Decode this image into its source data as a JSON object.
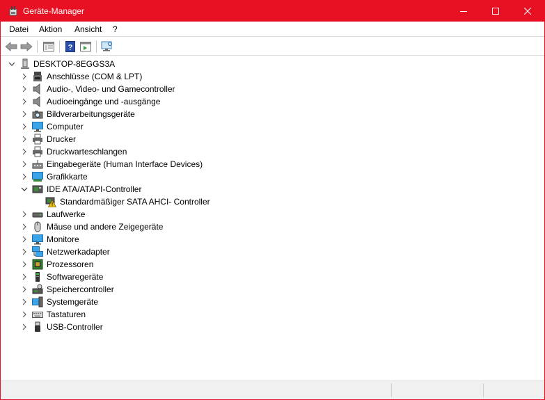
{
  "window": {
    "title": "Geräte-Manager",
    "accent": "#e81123"
  },
  "menu": {
    "items": [
      "Datei",
      "Aktion",
      "Ansicht",
      "?"
    ]
  },
  "toolbar": {
    "buttons": [
      "back-icon",
      "forward-icon",
      "properties-icon",
      "help-icon",
      "view-icon",
      "monitor-scan-icon"
    ]
  },
  "tree": {
    "root": "DESKTOP-8EGGS3A",
    "categories": [
      {
        "label": "Anschlüsse (COM & LPT)",
        "icon": "port-icon",
        "expanded": false
      },
      {
        "label": "Audio-, Video- und Gamecontroller",
        "icon": "speaker-icon",
        "expanded": false
      },
      {
        "label": "Audioeingänge und -ausgänge",
        "icon": "speaker-icon",
        "expanded": false
      },
      {
        "label": "Bildverarbeitungsgeräte",
        "icon": "camera-icon",
        "expanded": false
      },
      {
        "label": "Computer",
        "icon": "computer-icon",
        "expanded": false
      },
      {
        "label": "Drucker",
        "icon": "printer-icon",
        "expanded": false
      },
      {
        "label": "Druckwarteschlangen",
        "icon": "printer-icon",
        "expanded": false
      },
      {
        "label": "Eingabegeräte (Human Interface Devices)",
        "icon": "hid-icon",
        "expanded": false
      },
      {
        "label": "Grafikkarte",
        "icon": "display-adapter-icon",
        "expanded": false
      },
      {
        "label": "IDE ATA/ATAPI-Controller",
        "icon": "ide-controller-icon",
        "expanded": true
      },
      {
        "label": "Laufwerke",
        "icon": "disk-drive-icon",
        "expanded": false
      },
      {
        "label": "Mäuse und andere Zeigegeräte",
        "icon": "mouse-icon",
        "expanded": false
      },
      {
        "label": "Monitore",
        "icon": "monitor-icon",
        "expanded": false
      },
      {
        "label": "Netzwerkadapter",
        "icon": "network-icon",
        "expanded": false
      },
      {
        "label": "Prozessoren",
        "icon": "processor-icon",
        "expanded": false
      },
      {
        "label": "Softwaregeräte",
        "icon": "software-device-icon",
        "expanded": false
      },
      {
        "label": "Speichercontroller",
        "icon": "storage-controller-icon",
        "expanded": false
      },
      {
        "label": "Systemgeräte",
        "icon": "system-device-icon",
        "expanded": false
      },
      {
        "label": "Tastaturen",
        "icon": "keyboard-icon",
        "expanded": false
      },
      {
        "label": "USB-Controller",
        "icon": "usb-icon",
        "expanded": false
      }
    ],
    "children": {
      "IDE ATA/ATAPI-Controller": [
        {
          "label": "Standardmäßiger SATA AHCI- Controller",
          "icon": "warning-controller-icon"
        }
      ]
    }
  }
}
